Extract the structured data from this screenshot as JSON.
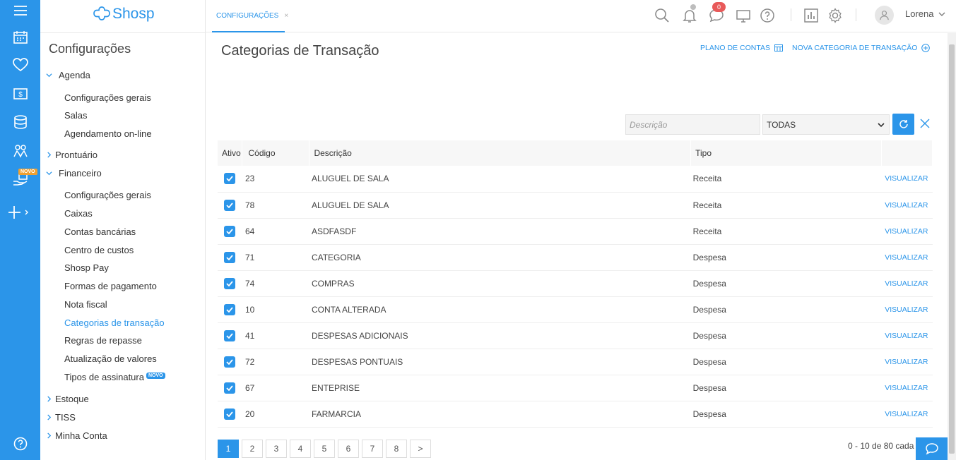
{
  "app": {
    "brand": "Shosp",
    "accent": "#2b95e9"
  },
  "rail": {
    "icons": [
      "menu-icon",
      "calendar-icon",
      "heart-icon",
      "money-icon",
      "database-icon",
      "people-icon",
      "hand-money-icon",
      "plus-icon",
      "help-icon"
    ],
    "novo_badge": "NOVO"
  },
  "sidebar": {
    "title": "Configurações",
    "groups": [
      {
        "label": "Agenda",
        "items": [
          "Configurações gerais",
          "Salas",
          "Agendamento on-line"
        ]
      },
      {
        "label": "Prontuário"
      },
      {
        "label": "Financeiro",
        "items": [
          "Configurações gerais",
          "Caixas",
          "Contas bancárias",
          "Centro de custos",
          "Shosp Pay",
          "Formas de pagamento",
          "Nota fiscal",
          "Categorias de transação",
          "Regras de repasse",
          "Atualização de valores",
          "Tipos de assinatura"
        ]
      },
      {
        "label": "Estoque"
      },
      {
        "label": "TISS"
      },
      {
        "label": "Minha Conta"
      }
    ],
    "novo_inline": "NOVO"
  },
  "topbar": {
    "tab_label": "CONFIGURAÇÕES",
    "tab_close": "×",
    "messages_count": "0",
    "user_name": "Lorena"
  },
  "page": {
    "title": "Categorias de Transação",
    "plano_link": "PLANO DE CONTAS",
    "nova_link": "NOVA CATEGORIA DE TRANSAÇÃO"
  },
  "filter": {
    "description_placeholder": "Descrição",
    "type_selected": "TODAS"
  },
  "table": {
    "headers": {
      "active": "Ativo",
      "code": "Código",
      "description": "Descrição",
      "type": "Tipo"
    },
    "rows": [
      {
        "code": "23",
        "description": "ALUGUEL DE SALA",
        "type": "Receita",
        "action": "VISUALIZAR"
      },
      {
        "code": "78",
        "description": "ALUGUEL DE SALA",
        "type": "Receita",
        "action": "VISUALIZAR"
      },
      {
        "code": "64",
        "description": "ASDFASDF",
        "type": "Receita",
        "action": "VISUALIZAR"
      },
      {
        "code": "71",
        "description": "CATEGORIA",
        "type": "Despesa",
        "action": "VISUALIZAR"
      },
      {
        "code": "74",
        "description": "COMPRAS",
        "type": "Despesa",
        "action": "VISUALIZAR"
      },
      {
        "code": "10",
        "description": "CONTA ALTERADA",
        "type": "Despesa",
        "action": "VISUALIZAR"
      },
      {
        "code": "41",
        "description": "DESPESAS ADICIONAIS",
        "type": "Despesa",
        "action": "VISUALIZAR"
      },
      {
        "code": "72",
        "description": "DESPESAS PONTUAIS",
        "type": "Despesa",
        "action": "VISUALIZAR"
      },
      {
        "code": "67",
        "description": "ENTEPRISE",
        "type": "Despesa",
        "action": "VISUALIZAR"
      },
      {
        "code": "20",
        "description": "FARMARCIA",
        "type": "Despesa",
        "action": "VISUALIZAR"
      }
    ]
  },
  "pagination": {
    "pages": [
      "1",
      "2",
      "3",
      "4",
      "5",
      "6",
      "7",
      "8"
    ],
    "next": ">",
    "current": "1",
    "summary": "0 - 10 de 80 cada"
  }
}
